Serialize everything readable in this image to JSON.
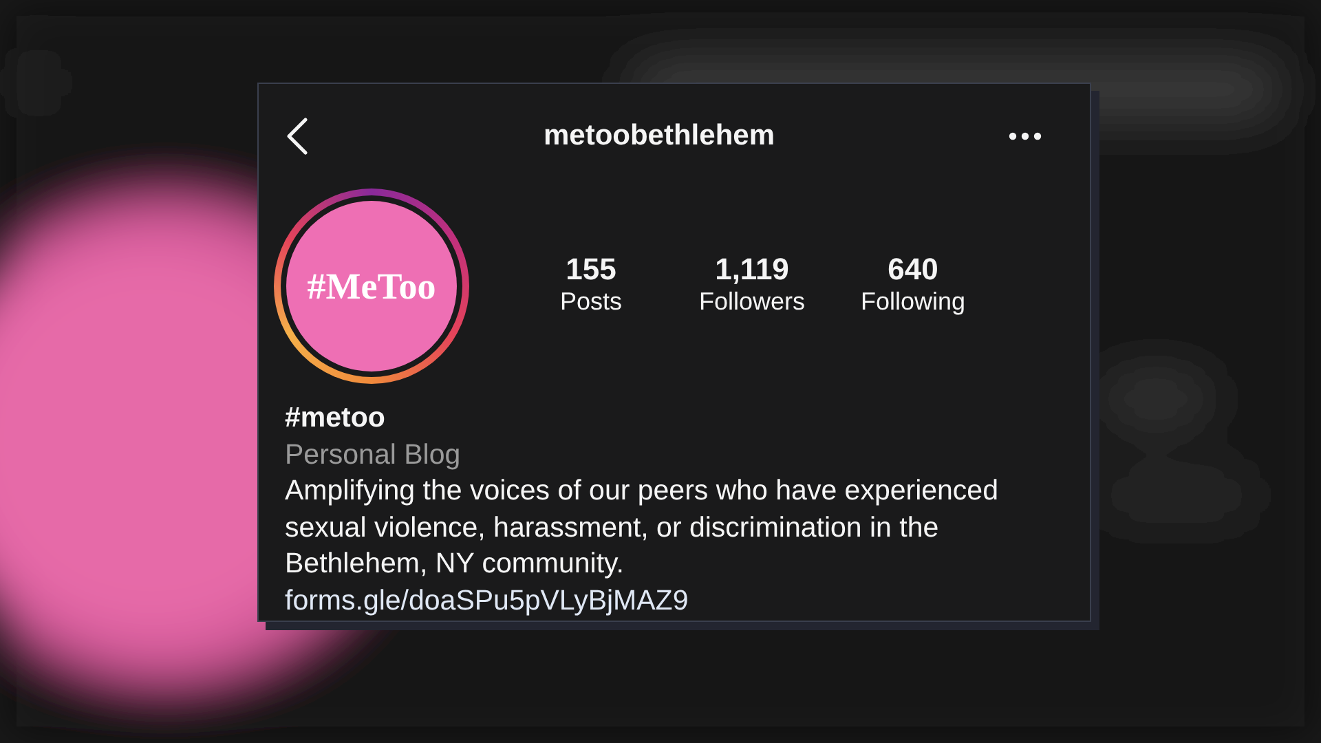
{
  "header": {
    "username": "metoobethlehem"
  },
  "avatar": {
    "text": "#MeToo"
  },
  "stats": [
    {
      "value": "155",
      "label": "Posts"
    },
    {
      "value": "1,119",
      "label": "Followers"
    },
    {
      "value": "640",
      "label": "Following"
    }
  ],
  "bio": {
    "name": "#metoo",
    "category": "Personal Blog",
    "description": "Amplifying the voices of our peers who have experienced sexual violence, harassment, or discrimination in the Bethlehem, NY community.",
    "link": "forms.gle/doaSPu5pVLyBjMAZ9"
  }
}
